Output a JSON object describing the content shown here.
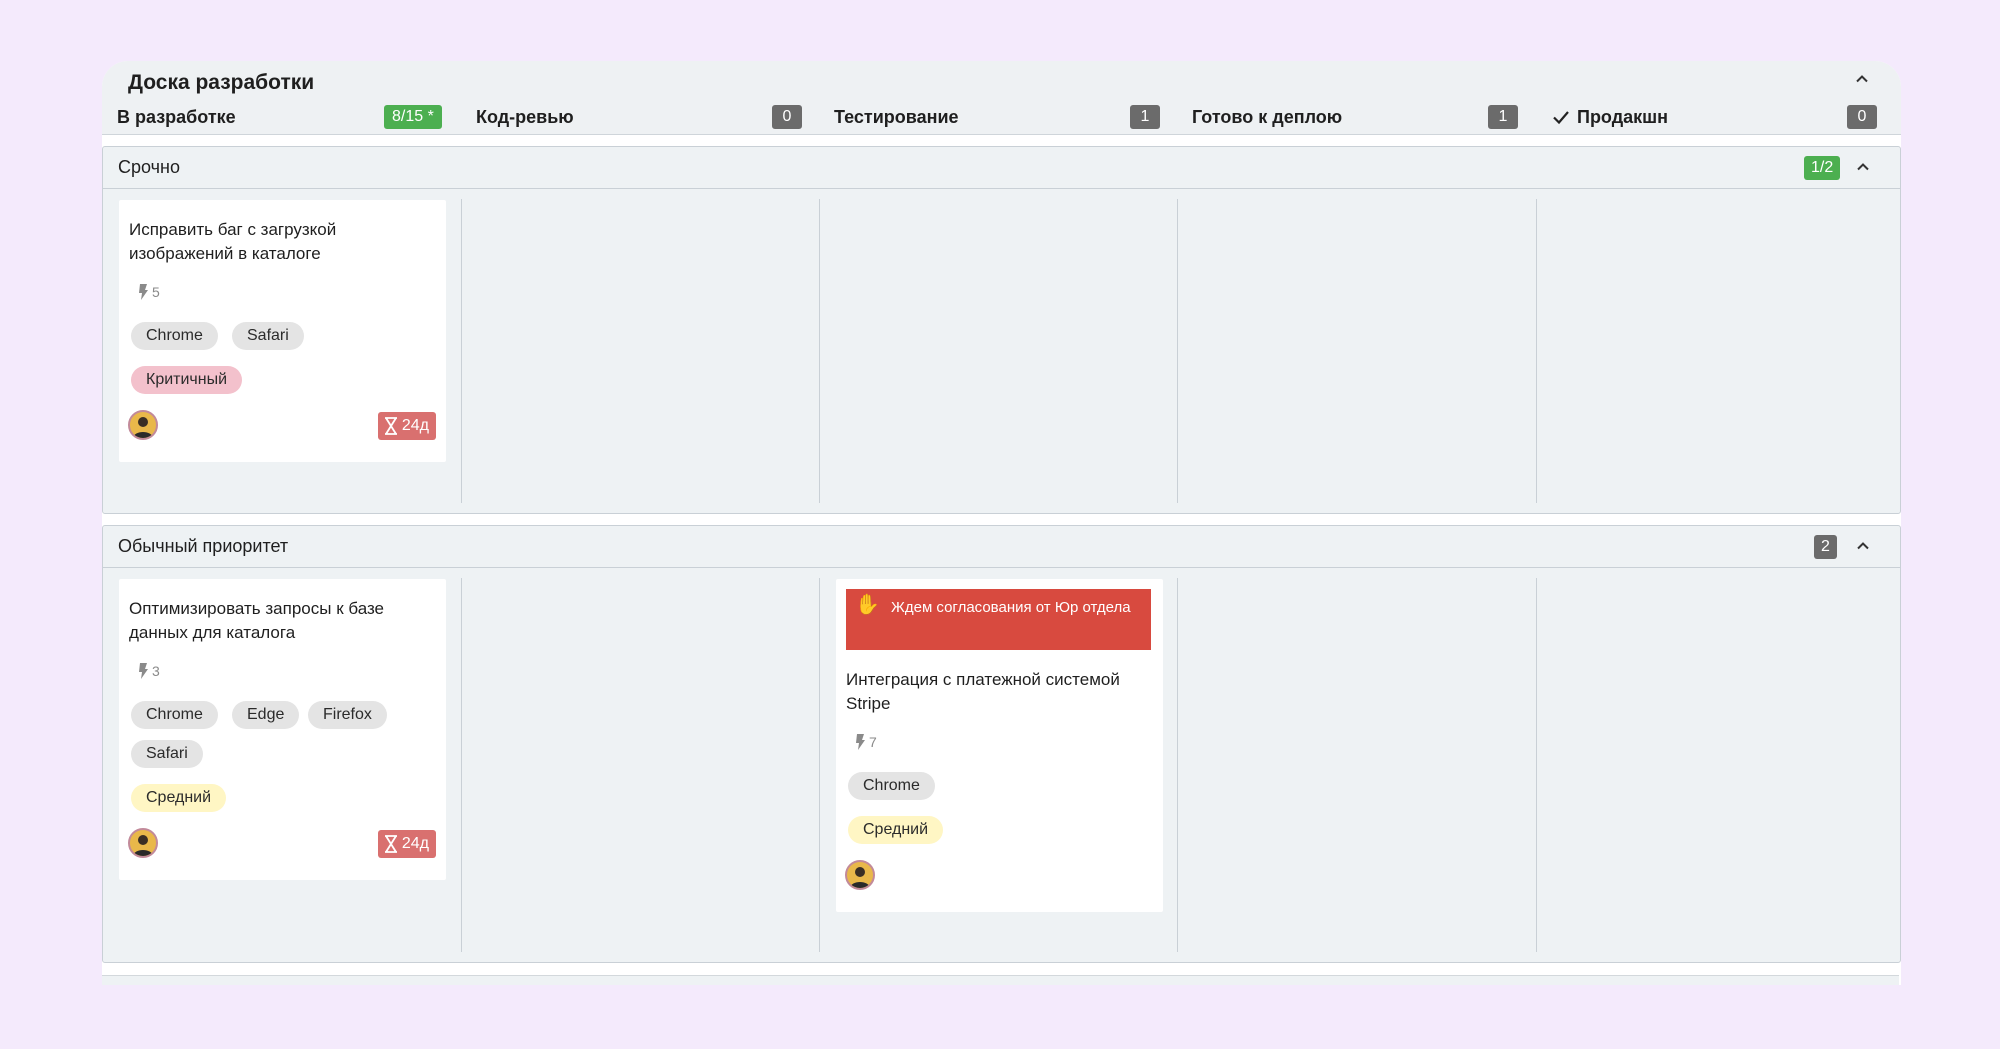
{
  "board": {
    "title": "Доска разработки",
    "columns": [
      {
        "title": "В разработке",
        "count": "8/15 *",
        "badge_color": "#4caf50"
      },
      {
        "title": "Код-ревью",
        "count": "0",
        "badge_color": "#6b6b6b"
      },
      {
        "title": "Тестирование",
        "count": "1",
        "badge_color": "#6b6b6b"
      },
      {
        "title": "Готово к деплою",
        "count": "1",
        "badge_color": "#6b6b6b"
      },
      {
        "title": "Продакшн",
        "count": "0",
        "badge_color": "#6b6b6b",
        "icon": "check-icon"
      }
    ]
  },
  "lanes": {
    "urgent": {
      "title": "Срочно",
      "count": "1/2",
      "card1": {
        "title": "Исправить баг с загрузкой изображений в каталоге",
        "points": "5",
        "tags": [
          "Chrome",
          "Safari"
        ],
        "priority": "Критичный",
        "due": "24д"
      }
    },
    "normal": {
      "title": "Обычный приоритет",
      "count": "2",
      "card1": {
        "title": "Оптимизировать запросы к базе данных для каталога",
        "points": "3",
        "tags": [
          "Chrome",
          "Edge",
          "Firefox",
          "Safari"
        ],
        "priority": "Средний",
        "due": "24д"
      },
      "card2": {
        "blocked": "Ждем согласования от Юр отдела",
        "title": "Интеграция с платежной системой Stripe",
        "points": "7",
        "tags": [
          "Chrome"
        ],
        "priority": "Средний"
      }
    }
  },
  "colors": {
    "background": "#f4eafc",
    "accent_green": "#4caf50",
    "blocked_red": "#d84a3f",
    "due_red": "#d9706f"
  }
}
